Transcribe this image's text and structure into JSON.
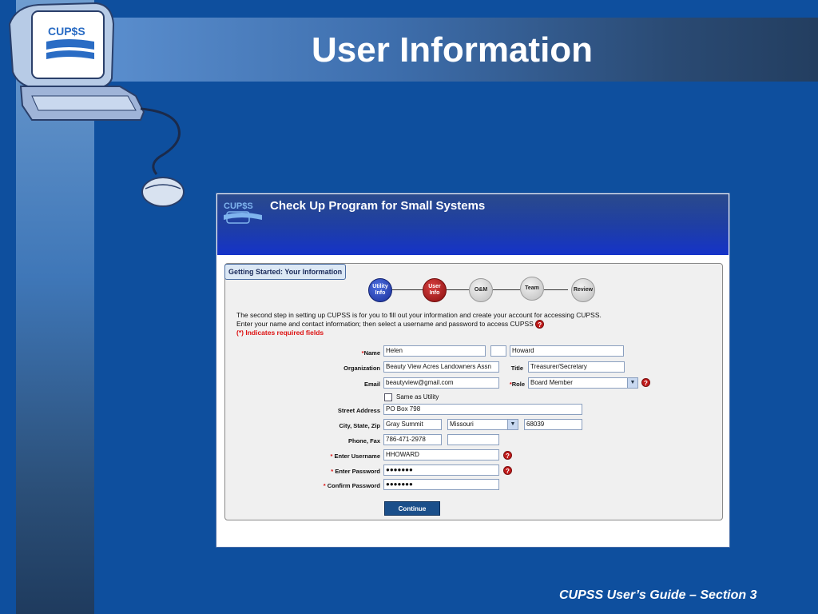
{
  "slide": {
    "title": "User Information",
    "footer": "CUPSS User’s Guide – Section 3",
    "logo_text": "CUP$S"
  },
  "app": {
    "logo_text": "CUP$S",
    "title": "Check Up Program for Small Systems",
    "panel_tab": "Getting Started: Your Information",
    "steps": [
      {
        "label": "Utility\nInfo",
        "state": "active"
      },
      {
        "label": "User\nInfo",
        "state": "current"
      },
      {
        "label": "O&M",
        "state": "pending"
      },
      {
        "label": "Team",
        "state": "pending"
      },
      {
        "label": "Review",
        "state": "pending"
      }
    ],
    "intro_line1": "The second step in setting up CUPSS is for you to fill out your information and create your account for accessing CUPSS.",
    "intro_line2": "Enter your name and contact information; then select a username and password to access CUPSS",
    "required_note": "(*) Indicates required fields",
    "help_icon": "help-icon",
    "form": {
      "name_label": "Name",
      "first_name": "Helen",
      "middle_initial": "",
      "last_name": "Howard",
      "organization_label": "Organization",
      "organization": "Beauty View Acres Landowners Assn",
      "title_label": "Title",
      "title_value": "Treasurer/Secretary",
      "email_label": "Email",
      "email": "beautyview@gmail.com",
      "role_label": "Role",
      "role": "Board Member",
      "same_as_utility_label": "Same as Utility",
      "street_label": "Street Address",
      "street": "PO Box 798",
      "city_state_zip_label": "City, State, Zip",
      "city": "Gray Summit",
      "state": "Missouri",
      "zip": "68039",
      "phone_fax_label": "Phone, Fax",
      "phone": "786-471-2978",
      "fax": "",
      "username_label": "Enter Username",
      "username": "HHOWARD",
      "password_label": "Enter Password",
      "password": "●●●●●●●",
      "confirm_label": "Confirm Password",
      "confirm": "●●●●●●●",
      "continue_label": "Continue",
      "required_star": "*"
    }
  },
  "colors": {
    "slide_bg": "#0e4f9e",
    "header_blue": "#1533c8",
    "step_current": "#a01818",
    "step_active": "#1a2f9a",
    "continue_bg": "#1b4f8a"
  }
}
